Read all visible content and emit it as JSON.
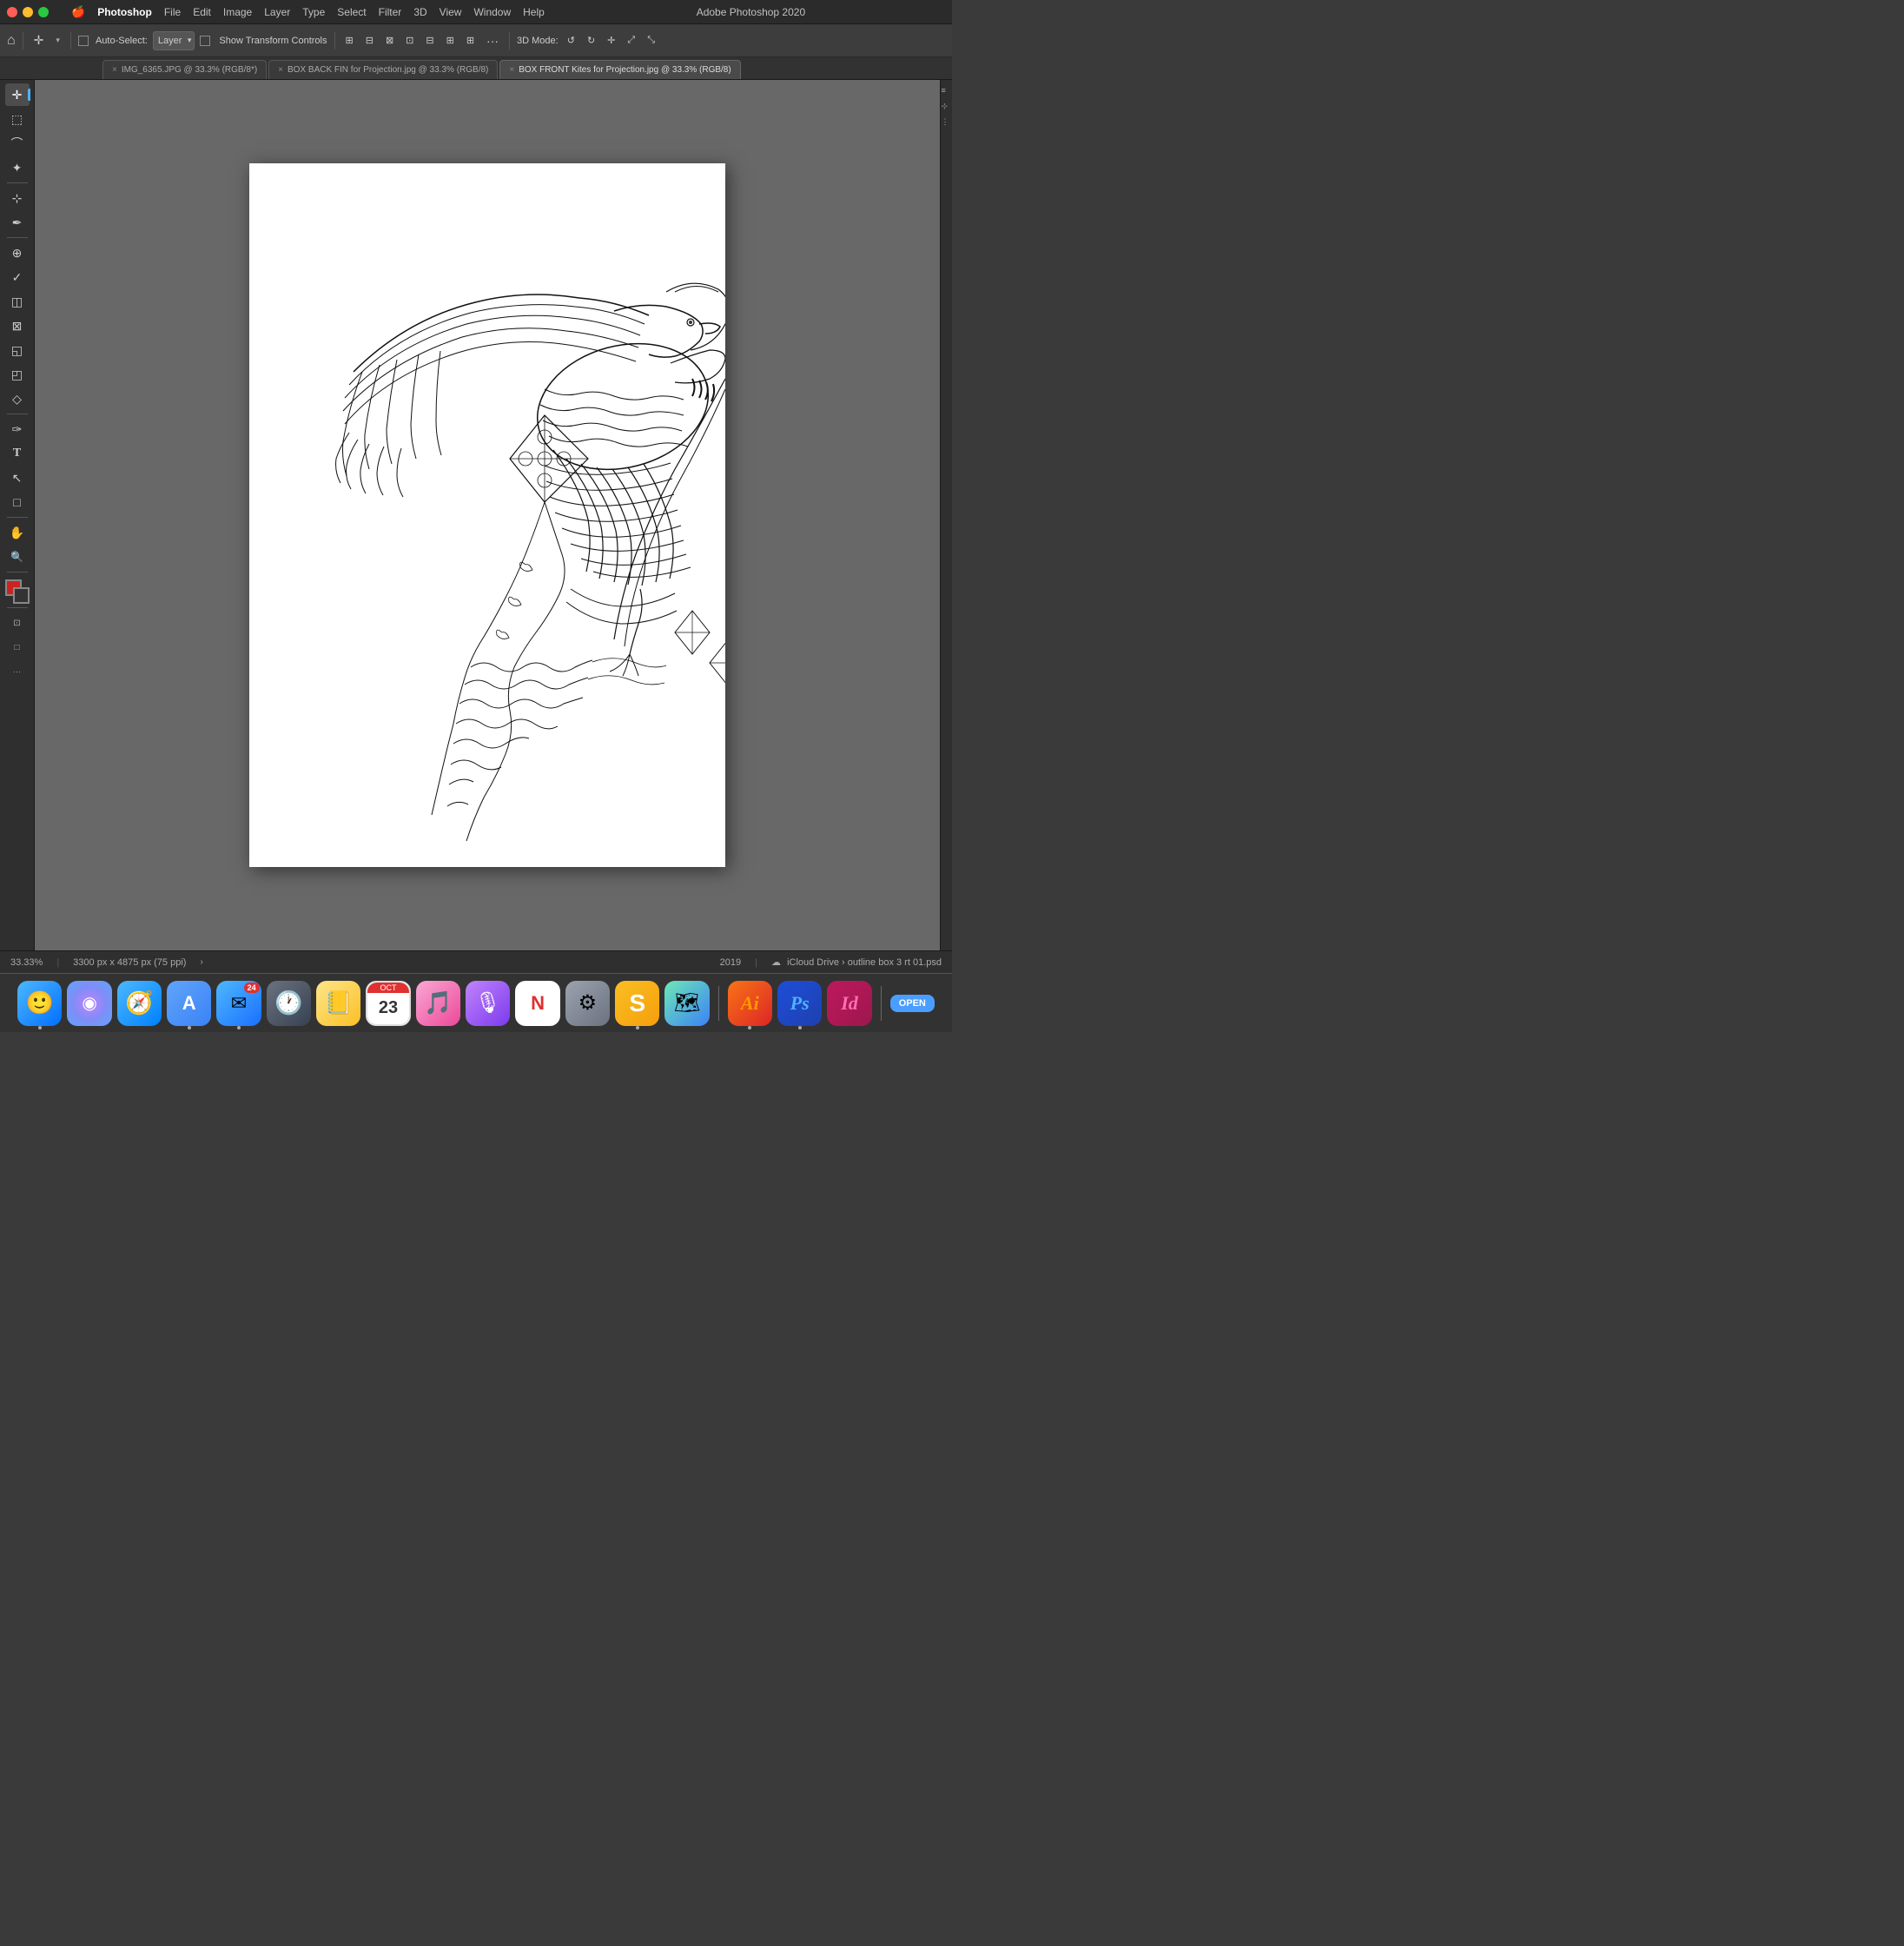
{
  "app": {
    "name": "Adobe Photoshop 2020",
    "title_bar": "Adobe Photoshop 2020"
  },
  "menu": {
    "apple": "🍎",
    "items": [
      "Photoshop",
      "File",
      "Edit",
      "Image",
      "Layer",
      "Type",
      "Select",
      "Filter",
      "3D",
      "View",
      "Window",
      "Help"
    ]
  },
  "options_bar": {
    "auto_select_label": "Auto-Select:",
    "layer_dropdown": "Layer",
    "transform_label": "Show Transform Controls",
    "mode_3d": "3D Mode:"
  },
  "tabs": [
    {
      "label": "IMG_6365.JPG @ 33.3% (RGB/8*)",
      "active": false
    },
    {
      "label": "BOX BACK FIN for Projection.jpg @ 33.3% (RGB/8)",
      "active": false
    },
    {
      "label": "BOX FRONT Kites for Projection.jpg @ 33.3% (RGB/8)",
      "active": true
    }
  ],
  "tools": [
    {
      "icon": "✛",
      "name": "move-tool",
      "active": true
    },
    {
      "icon": "⬚",
      "name": "selection-tool"
    },
    {
      "icon": "⌒",
      "name": "lasso-tool"
    },
    {
      "icon": "⊕",
      "name": "magic-wand-tool"
    },
    {
      "icon": "✂",
      "name": "crop-tool"
    },
    {
      "icon": "✦",
      "name": "spot-heal-tool"
    },
    {
      "icon": "✒",
      "name": "brush-tool"
    },
    {
      "icon": "⊠",
      "name": "stamp-tool"
    },
    {
      "icon": "◫",
      "name": "eraser-tool"
    },
    {
      "icon": "◰",
      "name": "gradient-tool"
    },
    {
      "icon": "◇",
      "name": "dodge-tool"
    },
    {
      "icon": "⬡",
      "name": "pen-tool"
    },
    {
      "icon": "T",
      "name": "type-tool"
    },
    {
      "icon": "↖",
      "name": "path-selection-tool"
    },
    {
      "icon": "□",
      "name": "shape-tool"
    },
    {
      "icon": "✋",
      "name": "hand-tool"
    },
    {
      "icon": "🔍",
      "name": "zoom-tool"
    },
    {
      "icon": "···",
      "name": "more-tools"
    }
  ],
  "status_bar": {
    "zoom": "33.33%",
    "dimensions": "3300 px x 4875 px (75 ppi)",
    "arrow": "›",
    "year": "2019",
    "breadcrumb": "iCloud Drive › outline box 3 rt 01.psd"
  },
  "dock": {
    "items": [
      {
        "id": "finder",
        "emoji": "🟦",
        "label": "Finder",
        "type": "finder"
      },
      {
        "id": "siri",
        "emoji": "◉",
        "label": "Siri",
        "type": "siri"
      },
      {
        "id": "safari",
        "emoji": "🧭",
        "label": "Safari",
        "type": "safari"
      },
      {
        "id": "appstore",
        "emoji": "Ⓐ",
        "label": "App Store",
        "type": "appstore"
      },
      {
        "id": "mail",
        "emoji": "✉",
        "label": "Mail",
        "type": "notes",
        "badge": "24"
      },
      {
        "id": "clock",
        "emoji": "🕐",
        "label": "Clock",
        "type": "clock"
      },
      {
        "id": "notes",
        "emoji": "📒",
        "label": "Notes",
        "type": "notes"
      },
      {
        "id": "calendar",
        "emoji": "31",
        "label": "Calendar",
        "type": "calendar"
      },
      {
        "id": "music",
        "emoji": "♫",
        "label": "Music",
        "type": "music"
      },
      {
        "id": "podcast",
        "emoji": "🎙",
        "label": "Podcasts",
        "type": "podcast"
      },
      {
        "id": "news",
        "emoji": "📰",
        "label": "News",
        "type": "news"
      },
      {
        "id": "settings",
        "emoji": "⚙",
        "label": "System Preferences",
        "type": "settings"
      },
      {
        "id": "scratch",
        "emoji": "S",
        "label": "Scratch",
        "type": "scratch"
      },
      {
        "id": "maps",
        "emoji": "🗺",
        "label": "Maps",
        "type": "maps"
      },
      {
        "id": "ai",
        "label": "Ai",
        "type": "ai"
      },
      {
        "id": "ps",
        "label": "Ps",
        "type": "ps"
      },
      {
        "id": "id",
        "label": "Id",
        "type": "id"
      },
      {
        "id": "open",
        "label": "OPEN",
        "type": "open"
      }
    ]
  }
}
